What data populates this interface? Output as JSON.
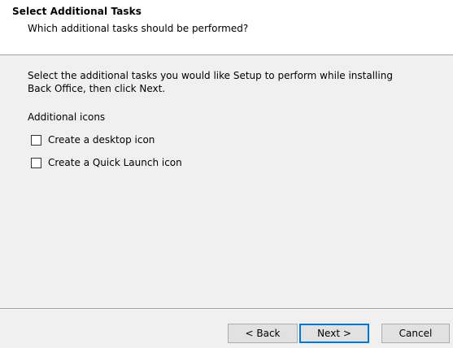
{
  "header": {
    "title": "Select Additional Tasks",
    "subtitle": "Which additional tasks should be performed?"
  },
  "content": {
    "instructions": "Select the additional tasks you would like Setup to perform while installing Back Office, then click Next.",
    "group_label": "Additional icons",
    "tasks": [
      {
        "label": "Create a desktop icon",
        "checked": false
      },
      {
        "label": "Create a Quick Launch icon",
        "checked": false
      }
    ]
  },
  "buttons": {
    "back": "< Back",
    "next": "Next >",
    "cancel": "Cancel"
  },
  "colors": {
    "accent": "#0078d7",
    "panel_bg": "#f0f0f0",
    "header_bg": "#ffffff"
  }
}
